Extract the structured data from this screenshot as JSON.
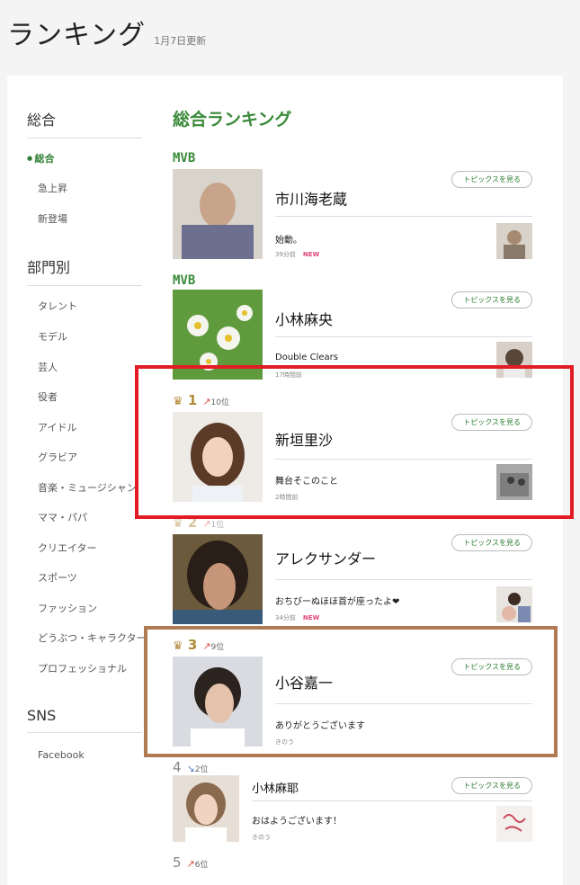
{
  "header": {
    "title": "ランキング",
    "updated": "1月7日更新"
  },
  "sidebar": {
    "section_overall": "総合",
    "overall_items": [
      "総合",
      "急上昇",
      "新登場"
    ],
    "section_category": "部門別",
    "category_items": [
      "タレント",
      "モデル",
      "芸人",
      "役者",
      "アイドル",
      "グラビア",
      "音楽・ミュージシャン",
      "ママ・パパ",
      "クリエイター",
      "スポーツ",
      "ファッション",
      "どうぶつ・キャラクター",
      "プロフェッショナル"
    ],
    "section_sns": "SNS",
    "sns_items": [
      "Facebook"
    ]
  },
  "main": {
    "title": "総合ランキング",
    "topics_label": "トピックスを見る",
    "new_label": "NEW",
    "entries": [
      {
        "badge": "MVB",
        "name": "市川海老蔵",
        "post": "始動。",
        "time": "39分前"
      },
      {
        "badge": "MVB",
        "name": "小林麻央",
        "post": "Double Clears",
        "time": "17時間前"
      },
      {
        "rank": "1",
        "move": "10位",
        "name": "新垣里沙",
        "post": "舞台そこのこと",
        "time": "2時間前"
      },
      {
        "rank": "2",
        "move": "1位",
        "name": "アレクサンダー",
        "post": "おちびーぬほほ首が座ったよ❤",
        "time": "34分前"
      },
      {
        "rank": "3",
        "move": "9位",
        "name": "小谷嘉一",
        "post": "ありがとうございます",
        "time": "きのう"
      },
      {
        "rank": "4",
        "move": "2位",
        "name": "小林麻耶",
        "post": "おはようございます！",
        "time": "きのう"
      },
      {
        "rank": "5",
        "move": "6位"
      }
    ]
  },
  "colors": {
    "accent": "#3a8a3a",
    "highlight_red": "#e21b24",
    "highlight_brown": "#b07a52",
    "crown_gold": "#b08a3a"
  }
}
